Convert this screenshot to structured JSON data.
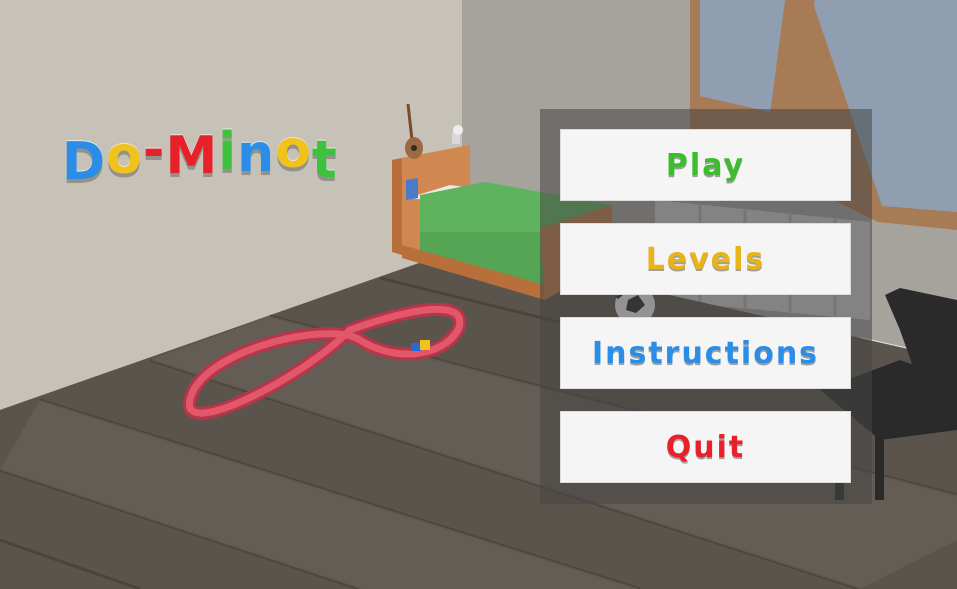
{
  "game": {
    "title_letters": [
      {
        "char": "D",
        "color": "#2a8ee8"
      },
      {
        "char": "o",
        "color": "#f1c21b"
      },
      {
        "char": "-",
        "color": "#e8202a"
      },
      {
        "char": "M",
        "color": "#e8202a"
      },
      {
        "char": "i",
        "color": "#3cc23c"
      },
      {
        "char": "n",
        "color": "#2a8ee8"
      },
      {
        "char": "o",
        "color": "#f1c21b"
      },
      {
        "char": "t",
        "color": "#3cc23c"
      }
    ]
  },
  "menu": {
    "buttons": [
      {
        "label": "Play",
        "color": "#3cbd2e"
      },
      {
        "label": "Levels",
        "color": "#e8b41a"
      },
      {
        "label": "Instructions",
        "color": "#2a8ee8"
      },
      {
        "label": "Quit",
        "color": "#e8202a"
      }
    ]
  },
  "icons": [
    "guitar-icon",
    "lamp-icon",
    "soccer-ball-icon",
    "toy-train-icon"
  ]
}
